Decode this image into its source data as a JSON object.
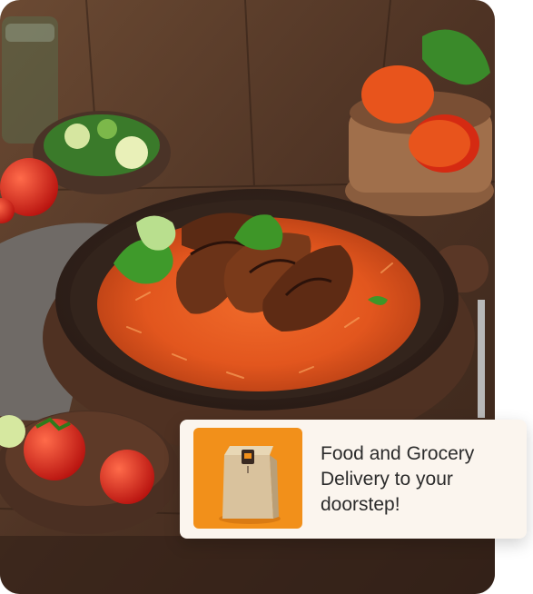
{
  "promo": {
    "text": "Food and Grocery Delivery to your doorstep!"
  },
  "icons": {
    "hero": "jollof-rice-with-chicken-photo",
    "thumb": "paper-bag-icon"
  },
  "colors": {
    "card_bg": "#fbf5ee",
    "thumb_bg": "#f2901a",
    "text": "#2b2b2b"
  }
}
